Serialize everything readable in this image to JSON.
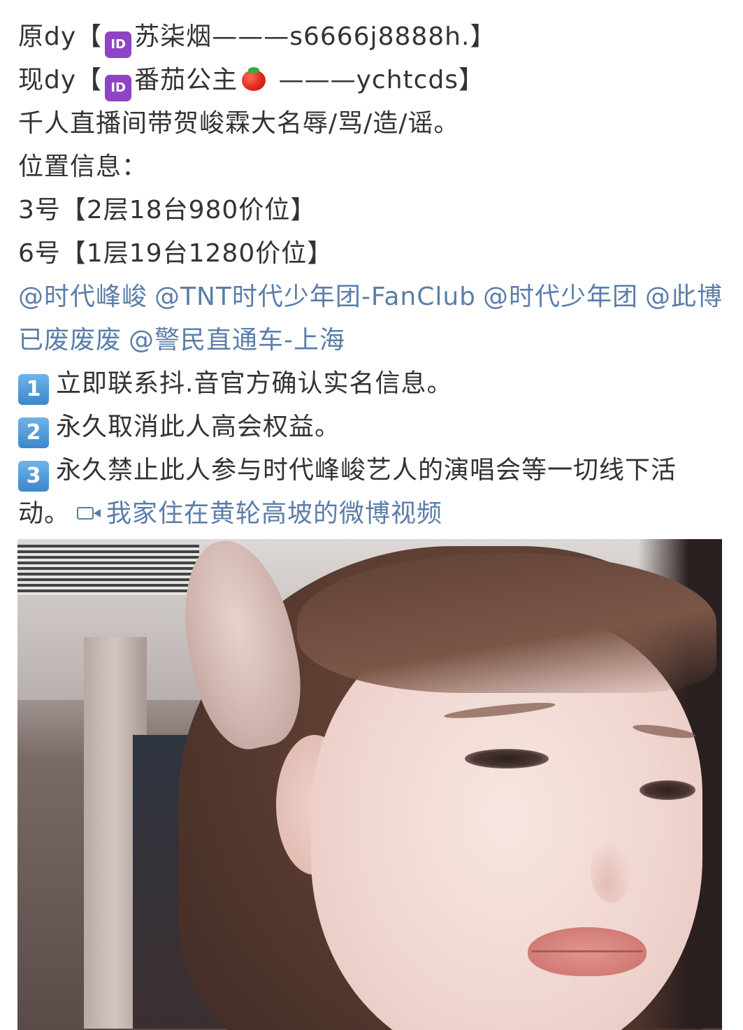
{
  "post": {
    "line1": {
      "prefix": "原dy【",
      "badge": "ID",
      "name": "苏柒烟",
      "suffix": "———s6666j8888h.】"
    },
    "line2": {
      "prefix": "现dy【",
      "badge": "ID",
      "name": "番茄公主",
      "emoji": "tomato-icon",
      "suffix": " ———ychtcds】"
    },
    "line3": "千人直播间带贺峻霖大名辱/骂/造/谣。",
    "line4": "位置信息：",
    "line5": "3号【2层18台980价位】",
    "line6": "6号【1层19台1280价位】",
    "mentions": [
      "@时代峰峻",
      "@TNT时代少年团-FanClub",
      "@时代少年团",
      "@此博已废废废",
      "@警民直通车-上海"
    ],
    "demands": [
      {
        "num": "1",
        "text": "立即联系抖.音官方确认实名信息。"
      },
      {
        "num": "2",
        "text": "永久取消此人高会权益。"
      },
      {
        "num": "3",
        "text": "永久禁止此人参与时代峰峻艺人的演唱会等一切线下活动。"
      }
    ],
    "video_link": "我家住在黄轮高坡的微博视频"
  },
  "colors": {
    "text": "#333333",
    "link": "#5b7ea8",
    "id_badge": "#8e44c4",
    "num_badge": "#3c88cc"
  }
}
